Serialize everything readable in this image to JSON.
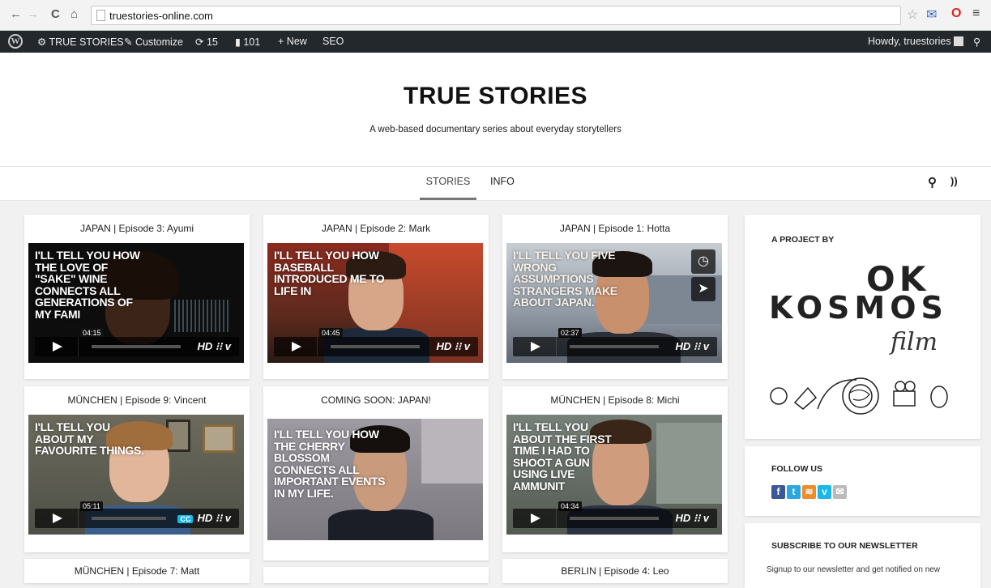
{
  "browser": {
    "url": "truestories-online.com"
  },
  "admin_bar": {
    "site_name": "TRUE STORIES",
    "customize": "Customize",
    "updates": "15",
    "comments": "101",
    "new": "New",
    "seo": "SEO",
    "howdy": "Howdy, truestories"
  },
  "site": {
    "title": "TRUE STORIES",
    "tagline": "A web-based documentary series about everyday storytellers"
  },
  "nav": {
    "stories": "STORIES",
    "info": "INFO"
  },
  "cards": [
    {
      "title": "JAPAN | Episode 3: Ayumi",
      "quote": "I'LL TELL YOU HOW THE LOVE OF \"SAKE\" WINE CONNECTS ALL GENERATIONS OF MY FAMI",
      "time": "04:15"
    },
    {
      "title": "JAPAN | Episode 2: Mark",
      "quote": "I'LL TELL YOU HOW BASEBALL INTRODUCED ME TO LIFE IN",
      "time": "04:45"
    },
    {
      "title": "JAPAN | Episode 1: Hotta",
      "quote": "I'LL TELL YOU FIVE WRONG ASSUMPTIONS STRANGERS MAKE ABOUT JAPAN.",
      "time": "02:37"
    },
    {
      "title": "MÜNCHEN | Episode 9: Vincent",
      "quote": "I'LL TELL YOU ABOUT MY FAVOURITE THINGS.",
      "time": "05:11"
    },
    {
      "title": "COMING SOON: JAPAN!",
      "quote": "I'LL TELL YOU HOW THE CHERRY BLOSSOM CONNECTS ALL IMPORTANT EVENTS IN MY LIFE."
    },
    {
      "title": "MÜNCHEN | Episode 8: Michi",
      "quote": "I'LL TELL YOU ABOUT THE FIRST TIME I HAD TO SHOOT A GUN USING LIVE AMMUNIT",
      "time": "04:34"
    },
    {
      "title": "MÜNCHEN | Episode 7: Matt"
    },
    {
      "title": "BERLIN | Episode 4: Leo"
    }
  ],
  "player": {
    "hd": "HD",
    "cc": "CC"
  },
  "sidebar": {
    "project_by": "A PROJECT BY",
    "logo_ok": "OK",
    "logo_kosmos": "KOSMOS",
    "logo_film": "film",
    "follow_us": "FOLLOW US",
    "social": [
      "facebook-icon",
      "twitter-icon",
      "rss-icon",
      "vimeo-icon",
      "email-icon"
    ],
    "newsletter_heading": "SUBSCRIBE TO OUR NEWSLETTER",
    "newsletter_text": "Signup to our newsletter and get notified on new"
  }
}
